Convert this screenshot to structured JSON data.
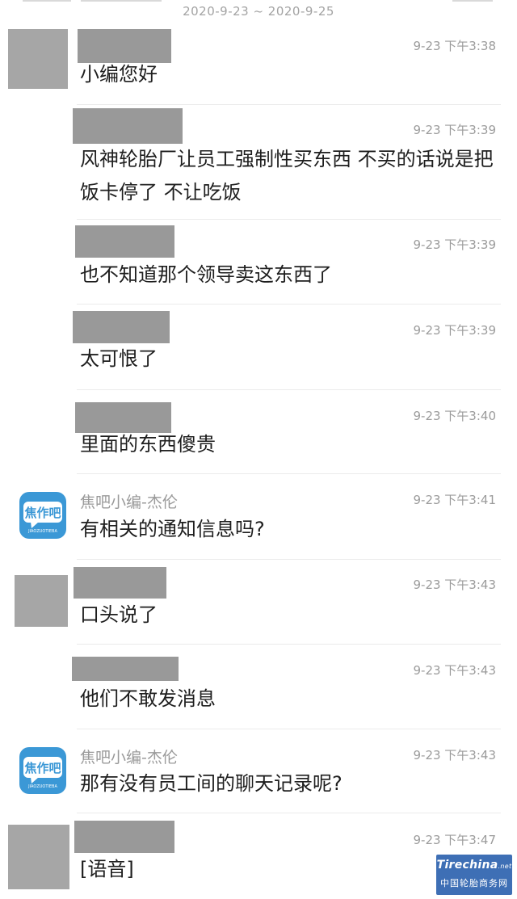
{
  "header": {
    "date_range": "2020-9-23 ~ 2020-9-25"
  },
  "icons": {
    "jiaoba_logo": {
      "text": "焦作吧",
      "subtext": "JIAOZUOTIEBA",
      "color": "#3b98d6"
    }
  },
  "messages": [
    {
      "time": "9-23 下午3:38",
      "text": "小编您好"
    },
    {
      "time": "9-23 下午3:39",
      "text": "风神轮胎厂让员工强制性买东西 不买的话说是把饭卡停了 不让吃饭"
    },
    {
      "time": "9-23 下午3:39",
      "text": "也不知道那个领导卖这东西了"
    },
    {
      "time": "9-23 下午3:39",
      "text": "太可恨了"
    },
    {
      "time": "9-23 下午3:40",
      "text": "里面的东西傻贵"
    },
    {
      "time": "9-23 下午3:41",
      "sender": "焦吧小编-杰伦",
      "text": "有相关的通知信息吗?"
    },
    {
      "time": "9-23 下午3:43",
      "text": "口头说了"
    },
    {
      "time": "9-23 下午3:43",
      "text": "他们不敢发消息"
    },
    {
      "time": "9-23 下午3:43",
      "sender": "焦吧小编-杰伦",
      "text": "那有没有员工间的聊天记录呢?"
    },
    {
      "time": "9-23 下午3:47",
      "text": "[语音]"
    }
  ],
  "watermark": {
    "brand": "Tirechina",
    "brand_suffix": ".net",
    "site_name": "中国轮胎商务网",
    "color": "#3e6fb5"
  }
}
